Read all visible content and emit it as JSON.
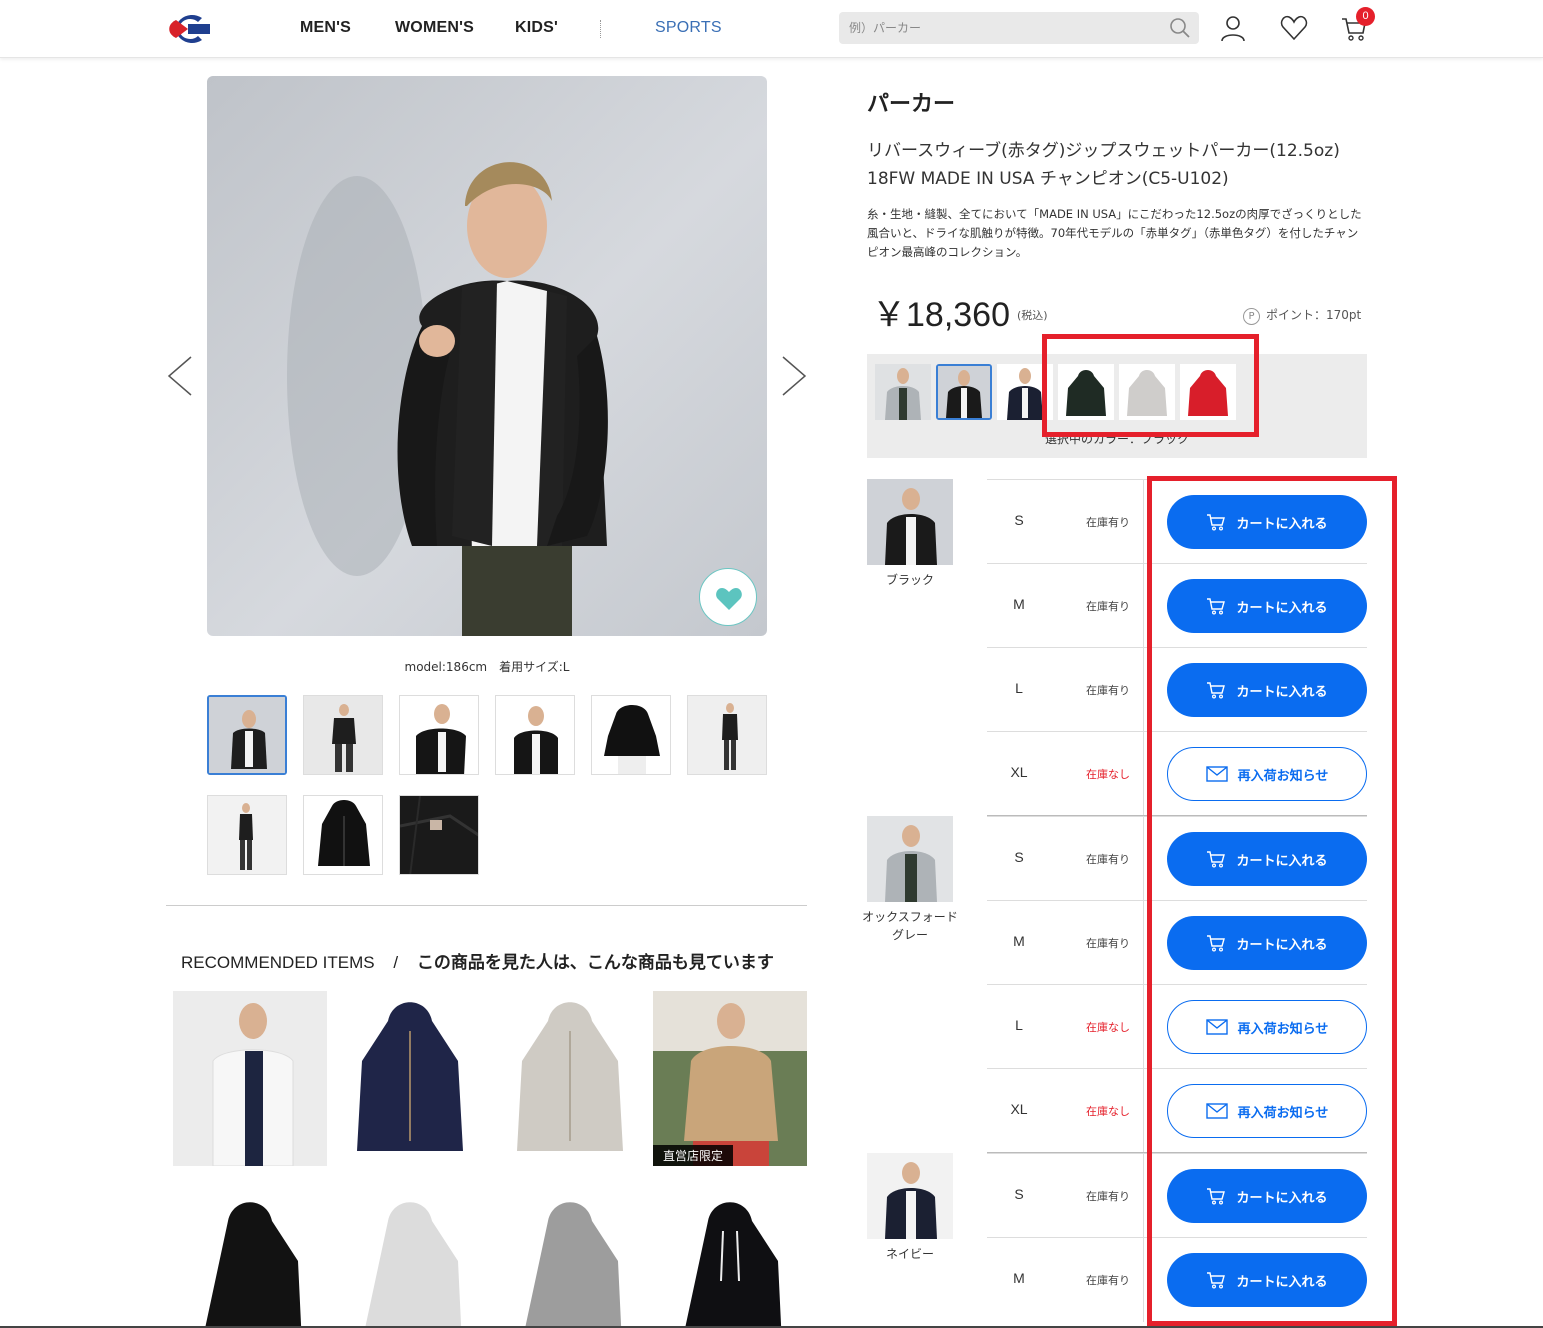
{
  "header": {
    "nav": [
      "MEN'S",
      "WOMEN'S",
      "KIDS'",
      "SPORTS"
    ],
    "search_placeholder": "例）パーカー",
    "cart_count": "0",
    "colors": {
      "sports": "#3a6fb5",
      "badge": "#e5202b"
    }
  },
  "gallery": {
    "model_caption": "model:186cm　着用サイズ:L"
  },
  "recommended": {
    "title_en": "RECOMMENDED ITEMS",
    "separator": "/",
    "title_jp": "この商品を見た人は、こんな商品も見ています",
    "badge": "直営店限定"
  },
  "product": {
    "category": "パーカー",
    "name_line1": "リバースウィーブ(赤タグ)ジップスウェットパーカー(12.5oz)",
    "name_line2": "18FW MADE IN USA チャンピオン(C5-U102)",
    "description": "糸・生地・縫製、全てにおいて「MADE IN USA」にこだわった12.5ozの肉厚でざっくりとした風合いと、ドライな肌触りが特徴。70年代モデルの「赤単タグ」（赤単色タグ）を付したチャンピオン最高峰のコレクション。",
    "price": "￥18,360",
    "tax_label": "(税込)",
    "points_icon": "P",
    "points": "ポイント：170pt",
    "selected_color_label": "選択中のカラー：ブラック",
    "accent": "#0a6cf0"
  },
  "variants": [
    {
      "name": "ブラック",
      "sizes": [
        {
          "size": "S",
          "stock": "在庫有り",
          "action": "カートに入れる"
        },
        {
          "size": "M",
          "stock": "在庫有り",
          "action": "カートに入れる"
        },
        {
          "size": "L",
          "stock": "在庫有り",
          "action": "カートに入れる"
        },
        {
          "size": "XL",
          "stock": "在庫なし",
          "action": "再入荷お知らせ"
        }
      ]
    },
    {
      "name": "オックスフォードグレー",
      "sizes": [
        {
          "size": "S",
          "stock": "在庫有り",
          "action": "カートに入れる"
        },
        {
          "size": "M",
          "stock": "在庫有り",
          "action": "カートに入れる"
        },
        {
          "size": "L",
          "stock": "在庫なし",
          "action": "再入荷お知らせ"
        },
        {
          "size": "XL",
          "stock": "在庫なし",
          "action": "再入荷お知らせ"
        }
      ]
    },
    {
      "name": "ネイビー",
      "sizes": [
        {
          "size": "S",
          "stock": "在庫有り",
          "action": "カートに入れる"
        },
        {
          "size": "M",
          "stock": "在庫有り",
          "action": "カートに入れる"
        }
      ]
    }
  ]
}
